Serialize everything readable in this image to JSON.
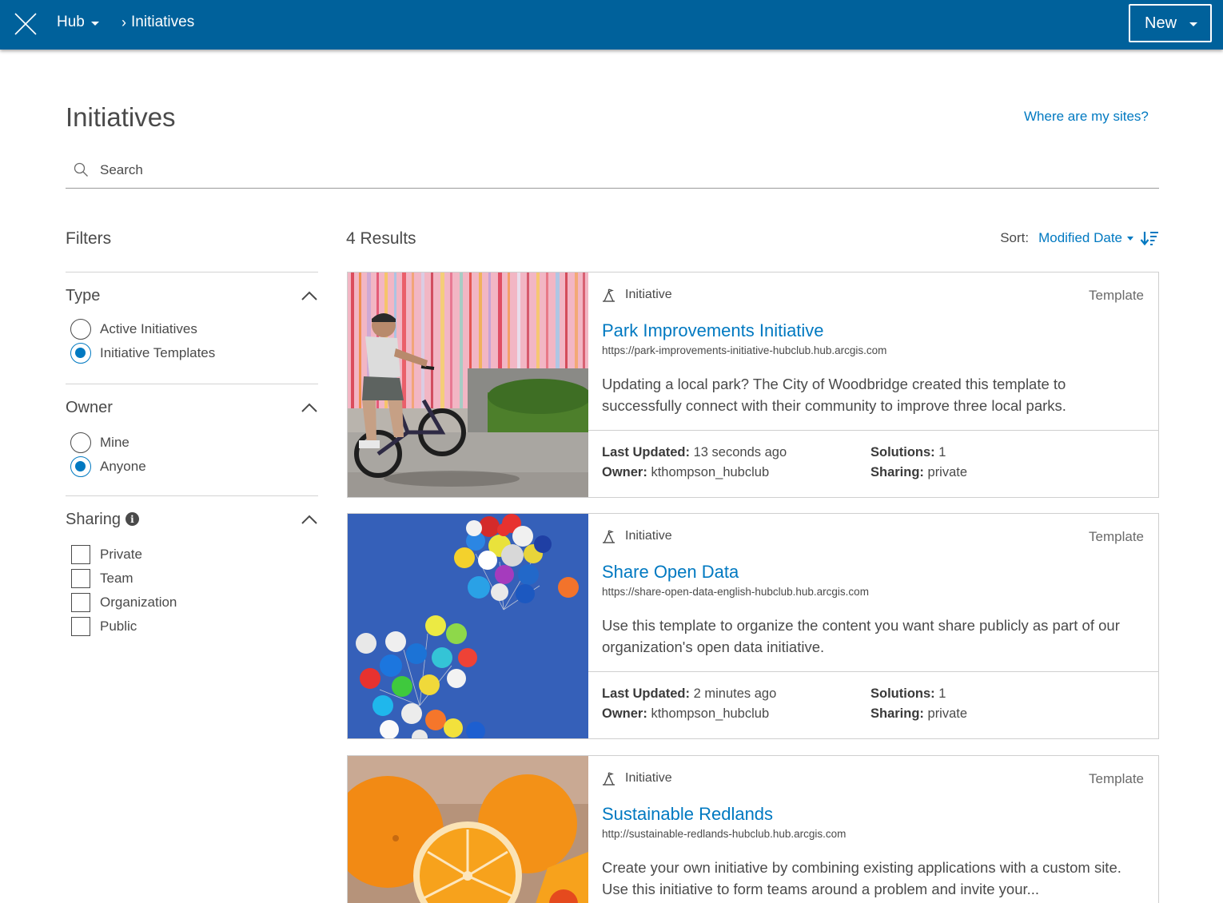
{
  "topbar": {
    "app_menu": "Hub",
    "breadcrumb": "Initiatives",
    "new_button": "New",
    "bg_color": "#00619b"
  },
  "page": {
    "title": "Initiatives",
    "help_link": "Where are my sites?",
    "search_placeholder": "Search"
  },
  "filters": {
    "title": "Filters",
    "type": {
      "label": "Type",
      "options": [
        {
          "label": "Active Initiatives",
          "selected": false
        },
        {
          "label": "Initiative Templates",
          "selected": true
        }
      ]
    },
    "owner": {
      "label": "Owner",
      "options": [
        {
          "label": "Mine",
          "selected": false
        },
        {
          "label": "Anyone",
          "selected": true
        }
      ]
    },
    "sharing": {
      "label": "Sharing",
      "options": [
        {
          "label": "Private",
          "checked": false
        },
        {
          "label": "Team",
          "checked": false
        },
        {
          "label": "Organization",
          "checked": false
        },
        {
          "label": "Public",
          "checked": false
        }
      ]
    }
  },
  "results": {
    "count_label": "4 Results",
    "sort_label": "Sort:",
    "sort_value": "Modified Date",
    "accent_color": "#0079c1",
    "items": [
      {
        "type": "Initiative",
        "badge": "Template",
        "title": "Park Improvements Initiative",
        "url": "https://park-improvements-initiative-hubclub.hub.arcgis.com",
        "description": "Updating a local park? The City of Woodbridge created this template to successfully connect with their community to improve three local parks.",
        "last_updated_label": "Last Updated:",
        "last_updated": "13 seconds ago",
        "owner_label": "Owner:",
        "owner": "kthompson_hubclub",
        "solutions_label": "Solutions:",
        "solutions": "1",
        "sharing_label": "Sharing:",
        "sharing": "private"
      },
      {
        "type": "Initiative",
        "badge": "Template",
        "title": "Share Open Data",
        "url": "https://share-open-data-english-hubclub.hub.arcgis.com",
        "description": "Use this template to organize the content you want share publicly as part of our organization's open data initiative.",
        "last_updated_label": "Last Updated:",
        "last_updated": "2 minutes ago",
        "owner_label": "Owner:",
        "owner": "kthompson_hubclub",
        "solutions_label": "Solutions:",
        "solutions": "1",
        "sharing_label": "Sharing:",
        "sharing": "private"
      },
      {
        "type": "Initiative",
        "badge": "Template",
        "title": "Sustainable Redlands",
        "url": "http://sustainable-redlands-hubclub.hub.arcgis.com",
        "description": "Create your own initiative by combining existing applications with a custom site. Use this initiative to form teams around a problem and invite your..."
      }
    ]
  }
}
